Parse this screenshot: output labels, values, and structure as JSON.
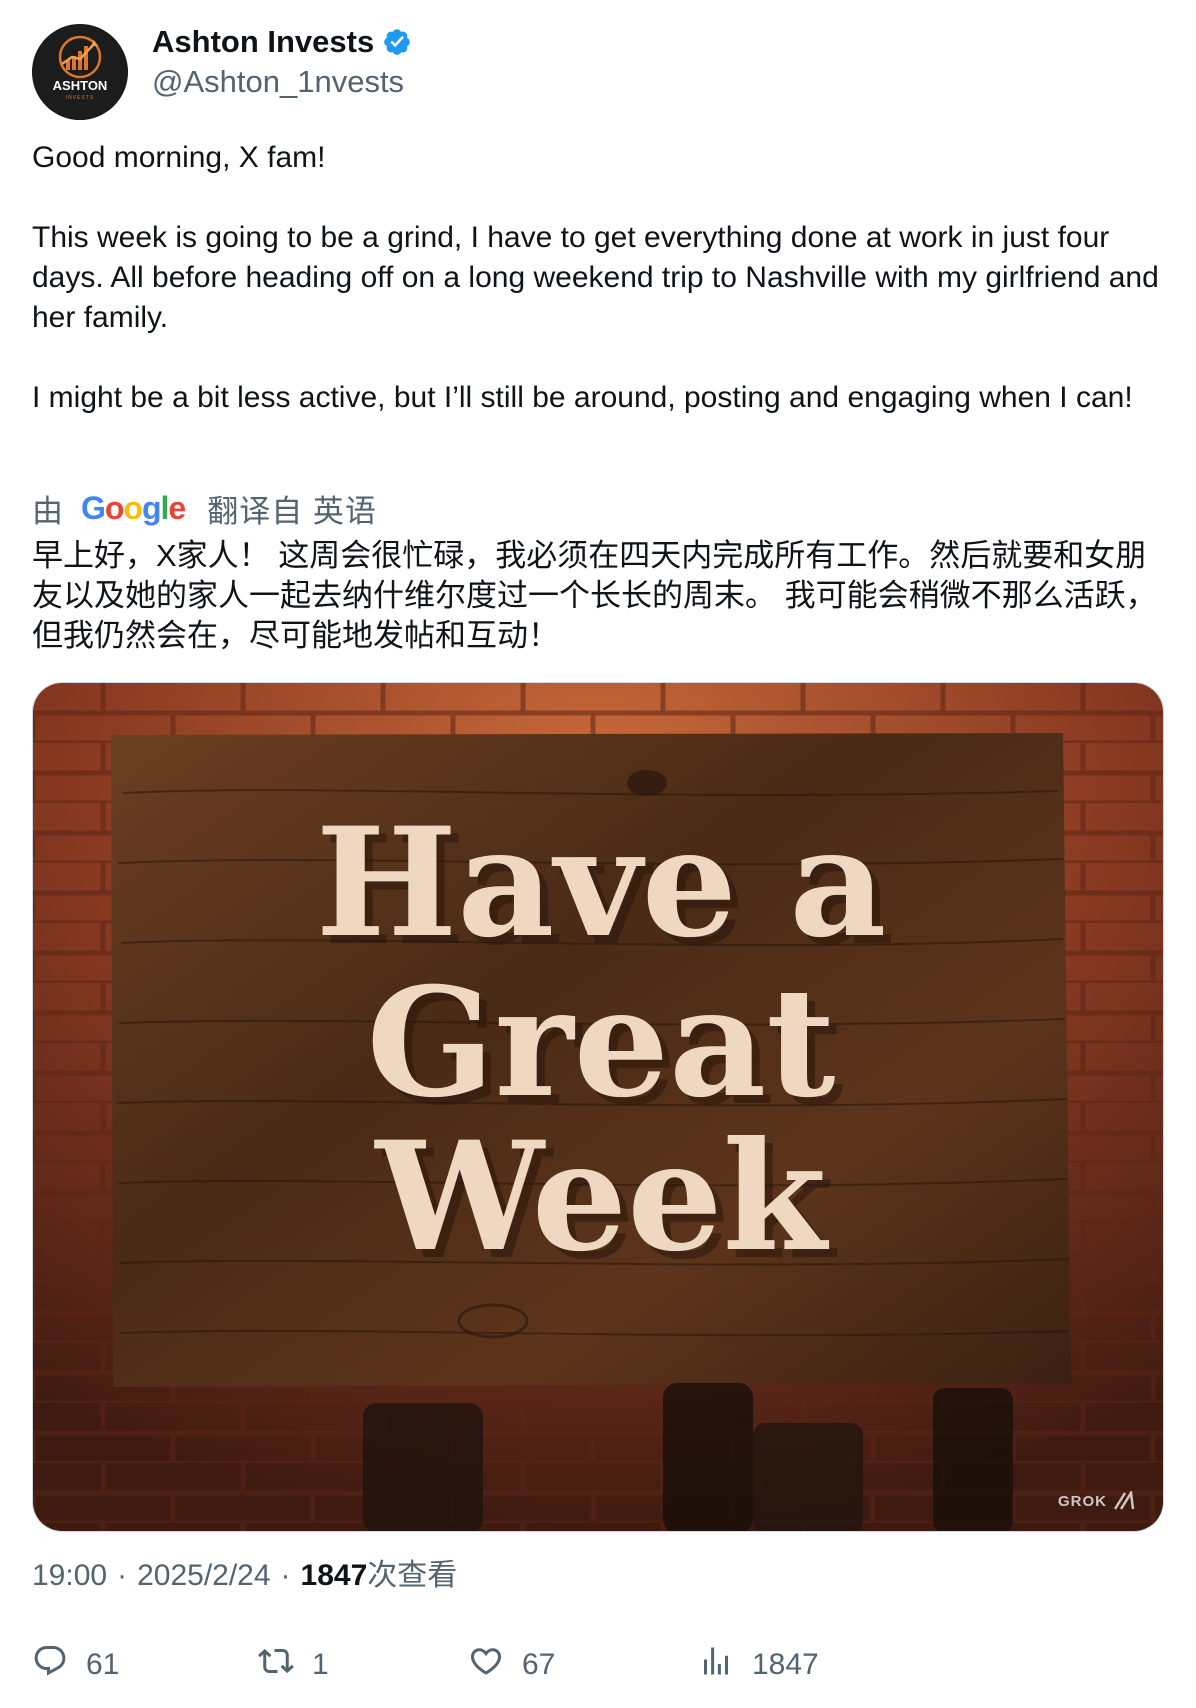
{
  "author": {
    "display_name": "Ashton Invests",
    "handle": "@Ashton_1nvests",
    "verified": true,
    "avatar_text": "ASHTON",
    "avatar_subtext": "INVESTS"
  },
  "tweet": {
    "paragraphs": [
      "Good morning, X fam!",
      "This week is going to be a grind, I have to get everything done at work in just four days. All before heading off on a long weekend trip to Nashville with my girlfriend and her family.",
      "I might be a bit less active, but I’ll still be around, posting and engaging when I can!"
    ]
  },
  "translation": {
    "by_label": "由",
    "provider": "Google",
    "from_label": "翻译自 英语",
    "text": "早上好，X家人！ 这周会很忙碌，我必须在四天内完成所有工作。然后就要和女朋友以及她的家人一起去纳什维尔度过一个长长的周末。 我可能会稍微不那么活跃，但我仍然会在，尽可能地发帖和互动！"
  },
  "media": {
    "sign_lines": [
      "Have a",
      "Great",
      "Week"
    ],
    "watermark": "GROK"
  },
  "meta": {
    "time": "19:00",
    "date": "2025/2/24",
    "views_count": "1847",
    "views_label": "次查看"
  },
  "actions": {
    "replies": "61",
    "reposts": "1",
    "likes": "67",
    "views": "1847"
  },
  "colors": {
    "text_primary": "#0f1419",
    "text_secondary": "#536471",
    "verified": "#1d9bf0"
  }
}
